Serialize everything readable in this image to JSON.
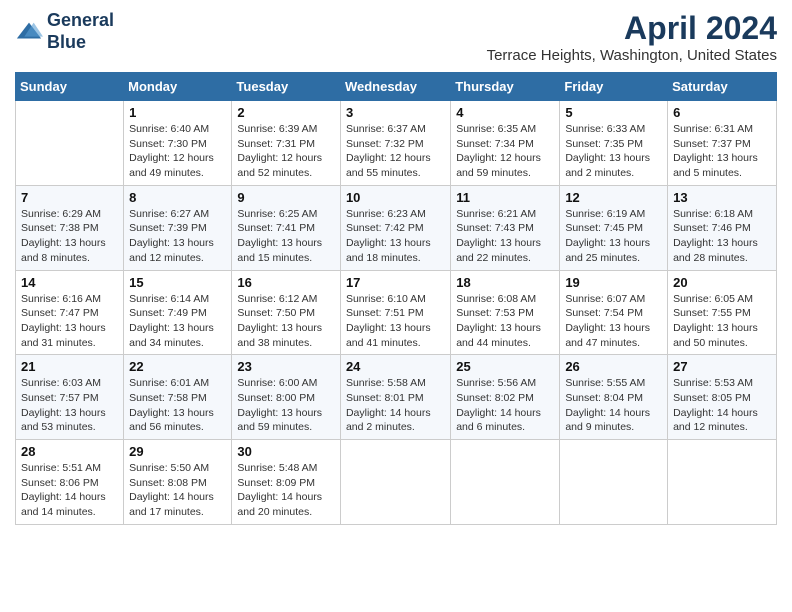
{
  "logo": {
    "line1": "General",
    "line2": "Blue"
  },
  "title": "April 2024",
  "subtitle": "Terrace Heights, Washington, United States",
  "days_of_week": [
    "Sunday",
    "Monday",
    "Tuesday",
    "Wednesday",
    "Thursday",
    "Friday",
    "Saturday"
  ],
  "weeks": [
    [
      {
        "day": "",
        "info": ""
      },
      {
        "day": "1",
        "info": "Sunrise: 6:40 AM\nSunset: 7:30 PM\nDaylight: 12 hours\nand 49 minutes."
      },
      {
        "day": "2",
        "info": "Sunrise: 6:39 AM\nSunset: 7:31 PM\nDaylight: 12 hours\nand 52 minutes."
      },
      {
        "day": "3",
        "info": "Sunrise: 6:37 AM\nSunset: 7:32 PM\nDaylight: 12 hours\nand 55 minutes."
      },
      {
        "day": "4",
        "info": "Sunrise: 6:35 AM\nSunset: 7:34 PM\nDaylight: 12 hours\nand 59 minutes."
      },
      {
        "day": "5",
        "info": "Sunrise: 6:33 AM\nSunset: 7:35 PM\nDaylight: 13 hours\nand 2 minutes."
      },
      {
        "day": "6",
        "info": "Sunrise: 6:31 AM\nSunset: 7:37 PM\nDaylight: 13 hours\nand 5 minutes."
      }
    ],
    [
      {
        "day": "7",
        "info": "Sunrise: 6:29 AM\nSunset: 7:38 PM\nDaylight: 13 hours\nand 8 minutes."
      },
      {
        "day": "8",
        "info": "Sunrise: 6:27 AM\nSunset: 7:39 PM\nDaylight: 13 hours\nand 12 minutes."
      },
      {
        "day": "9",
        "info": "Sunrise: 6:25 AM\nSunset: 7:41 PM\nDaylight: 13 hours\nand 15 minutes."
      },
      {
        "day": "10",
        "info": "Sunrise: 6:23 AM\nSunset: 7:42 PM\nDaylight: 13 hours\nand 18 minutes."
      },
      {
        "day": "11",
        "info": "Sunrise: 6:21 AM\nSunset: 7:43 PM\nDaylight: 13 hours\nand 22 minutes."
      },
      {
        "day": "12",
        "info": "Sunrise: 6:19 AM\nSunset: 7:45 PM\nDaylight: 13 hours\nand 25 minutes."
      },
      {
        "day": "13",
        "info": "Sunrise: 6:18 AM\nSunset: 7:46 PM\nDaylight: 13 hours\nand 28 minutes."
      }
    ],
    [
      {
        "day": "14",
        "info": "Sunrise: 6:16 AM\nSunset: 7:47 PM\nDaylight: 13 hours\nand 31 minutes."
      },
      {
        "day": "15",
        "info": "Sunrise: 6:14 AM\nSunset: 7:49 PM\nDaylight: 13 hours\nand 34 minutes."
      },
      {
        "day": "16",
        "info": "Sunrise: 6:12 AM\nSunset: 7:50 PM\nDaylight: 13 hours\nand 38 minutes."
      },
      {
        "day": "17",
        "info": "Sunrise: 6:10 AM\nSunset: 7:51 PM\nDaylight: 13 hours\nand 41 minutes."
      },
      {
        "day": "18",
        "info": "Sunrise: 6:08 AM\nSunset: 7:53 PM\nDaylight: 13 hours\nand 44 minutes."
      },
      {
        "day": "19",
        "info": "Sunrise: 6:07 AM\nSunset: 7:54 PM\nDaylight: 13 hours\nand 47 minutes."
      },
      {
        "day": "20",
        "info": "Sunrise: 6:05 AM\nSunset: 7:55 PM\nDaylight: 13 hours\nand 50 minutes."
      }
    ],
    [
      {
        "day": "21",
        "info": "Sunrise: 6:03 AM\nSunset: 7:57 PM\nDaylight: 13 hours\nand 53 minutes."
      },
      {
        "day": "22",
        "info": "Sunrise: 6:01 AM\nSunset: 7:58 PM\nDaylight: 13 hours\nand 56 minutes."
      },
      {
        "day": "23",
        "info": "Sunrise: 6:00 AM\nSunset: 8:00 PM\nDaylight: 13 hours\nand 59 minutes."
      },
      {
        "day": "24",
        "info": "Sunrise: 5:58 AM\nSunset: 8:01 PM\nDaylight: 14 hours\nand 2 minutes."
      },
      {
        "day": "25",
        "info": "Sunrise: 5:56 AM\nSunset: 8:02 PM\nDaylight: 14 hours\nand 6 minutes."
      },
      {
        "day": "26",
        "info": "Sunrise: 5:55 AM\nSunset: 8:04 PM\nDaylight: 14 hours\nand 9 minutes."
      },
      {
        "day": "27",
        "info": "Sunrise: 5:53 AM\nSunset: 8:05 PM\nDaylight: 14 hours\nand 12 minutes."
      }
    ],
    [
      {
        "day": "28",
        "info": "Sunrise: 5:51 AM\nSunset: 8:06 PM\nDaylight: 14 hours\nand 14 minutes."
      },
      {
        "day": "29",
        "info": "Sunrise: 5:50 AM\nSunset: 8:08 PM\nDaylight: 14 hours\nand 17 minutes."
      },
      {
        "day": "30",
        "info": "Sunrise: 5:48 AM\nSunset: 8:09 PM\nDaylight: 14 hours\nand 20 minutes."
      },
      {
        "day": "",
        "info": ""
      },
      {
        "day": "",
        "info": ""
      },
      {
        "day": "",
        "info": ""
      },
      {
        "day": "",
        "info": ""
      }
    ]
  ]
}
